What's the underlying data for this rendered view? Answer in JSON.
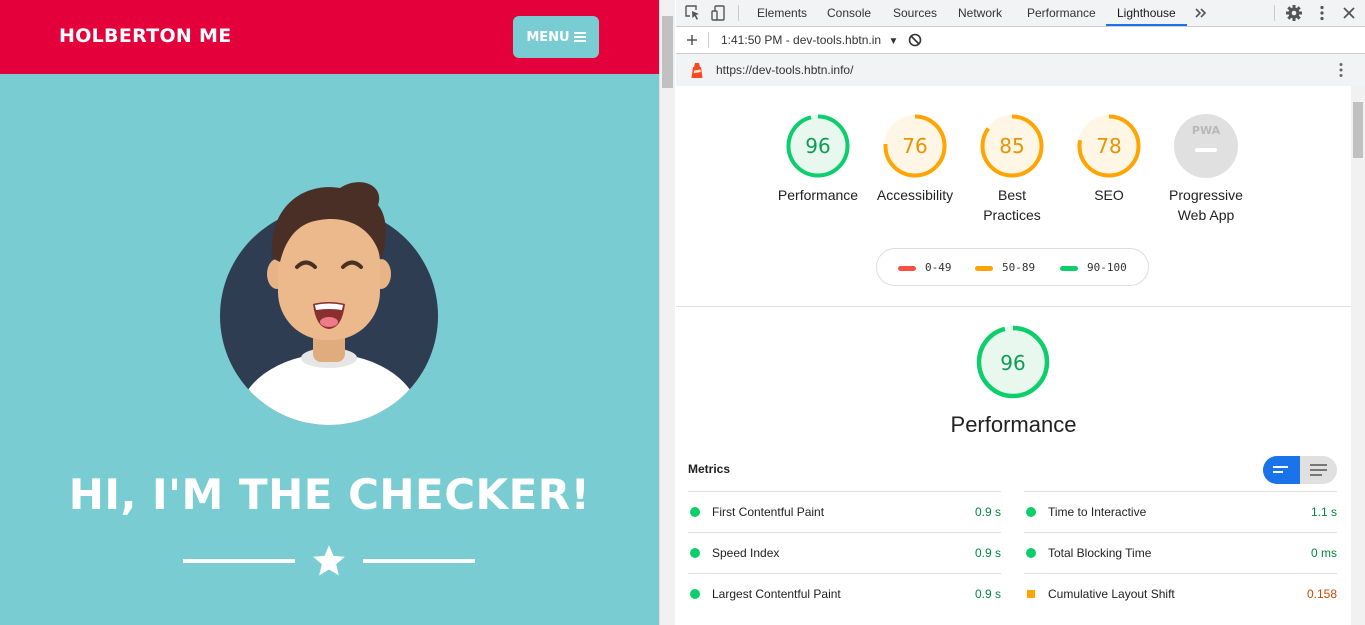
{
  "site": {
    "brand": "HOLBERTON ME",
    "menu_label": "MENU",
    "hero_title": "HI, I'M THE CHECKER!",
    "colors": {
      "header": "#e4013b",
      "background": "#79cdd2",
      "avatar_bg": "#2e3d52"
    }
  },
  "devtools": {
    "tabs": [
      "Elements",
      "Console",
      "Sources",
      "Network",
      "Performance",
      "Lighthouse"
    ],
    "active_tab": "Lighthouse",
    "more_tabs_icon": "double-chevron-icon",
    "report_select": "1:41:50 PM - dev-tools.hbtn.in",
    "url": "https://dev-tools.hbtn.info/"
  },
  "scores": {
    "performance": {
      "label": "Performance",
      "value": "96",
      "fraction": 0.96
    },
    "accessibility": {
      "label": "Accessibility",
      "value": "76",
      "fraction": 0.76
    },
    "best_practices": {
      "label_line1": "Best",
      "label_line2": "Practices",
      "value": "85",
      "fraction": 0.85
    },
    "seo": {
      "label": "SEO",
      "value": "78",
      "fraction": 0.78
    },
    "pwa": {
      "label_line1": "Progressive",
      "label_line2": "Web App",
      "badge": "PWA"
    }
  },
  "legend": [
    {
      "range": "0-49",
      "color": "#ff4e42"
    },
    {
      "range": "50-89",
      "color": "#ffa400"
    },
    {
      "range": "90-100",
      "color": "#0cce6b"
    }
  ],
  "performance_section": {
    "title": "Performance",
    "score": "96",
    "metrics_heading": "Metrics",
    "metrics_left": [
      {
        "name": "First Contentful Paint",
        "value": "0.9 s",
        "status": "pass"
      },
      {
        "name": "Speed Index",
        "value": "0.9 s",
        "status": "pass"
      },
      {
        "name": "Largest Contentful Paint",
        "value": "0.9 s",
        "status": "pass"
      }
    ],
    "metrics_right": [
      {
        "name": "Time to Interactive",
        "value": "1.1 s",
        "status": "pass"
      },
      {
        "name": "Total Blocking Time",
        "value": "0 ms",
        "status": "pass"
      },
      {
        "name": "Cumulative Layout Shift",
        "value": "0.158",
        "status": "average"
      }
    ]
  }
}
